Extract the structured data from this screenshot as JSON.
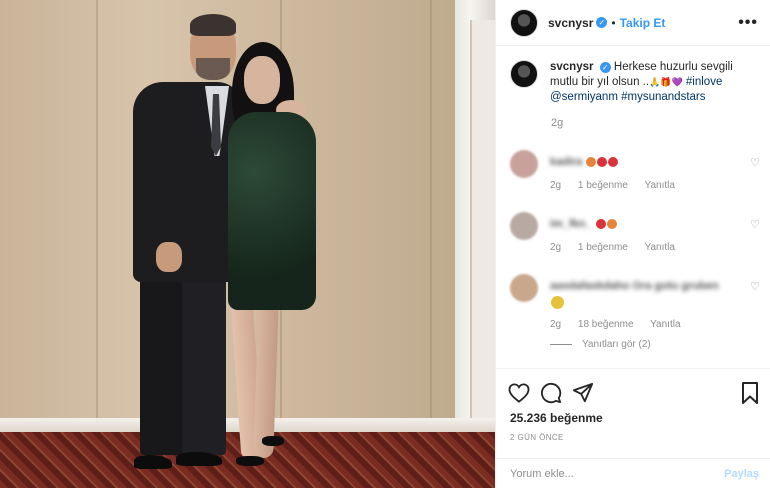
{
  "post": {
    "username": "svcnysr",
    "follow_label": "Takip Et",
    "separator": "•",
    "more_label": "•••",
    "caption": {
      "username": "svcnysr",
      "text": " Herkese huzurlu sevgili mutlu bir yıl olsun ..",
      "emojis": "🙏🎁💜",
      "hashtag1": "#inlove",
      "mention": "@sermiyanm",
      "hashtag2": "#mysunandstars",
      "time": "2g"
    },
    "comments": [
      {
        "user": "kadira",
        "emojis": [
          "#e8833a",
          "#d9343b",
          "#d9343b"
        ],
        "time": "2g",
        "likes": "1 beğenme",
        "reply": "Yanıtla"
      },
      {
        "user": "im_fkn_",
        "emojis": [
          "#d9343b",
          "#e8833a"
        ],
        "time": "2g",
        "likes": "1 beğenme",
        "reply": "Yanıtla"
      },
      {
        "user": "aasdafaskdaho Ora gotu gruben",
        "emojis": [
          "#e4c23a"
        ],
        "time": "2g",
        "likes": "18 beğenme",
        "reply": "Yanıtla",
        "view_replies": "Yanıtları gör (2)"
      }
    ],
    "likes": "25.236 beğenme",
    "date": "2 GÜN ÖNCE",
    "comment_placeholder": "Yorum ekle...",
    "post_button": "Paylaş",
    "colors": {
      "accent": "#3897f0",
      "muted": "#8e8e8e",
      "link": "#003569",
      "post_disabled": "#b3dbff"
    },
    "icons": [
      "heart-icon",
      "comment-icon",
      "share-icon",
      "bookmark-icon",
      "verified-icon",
      "more-icon"
    ]
  }
}
